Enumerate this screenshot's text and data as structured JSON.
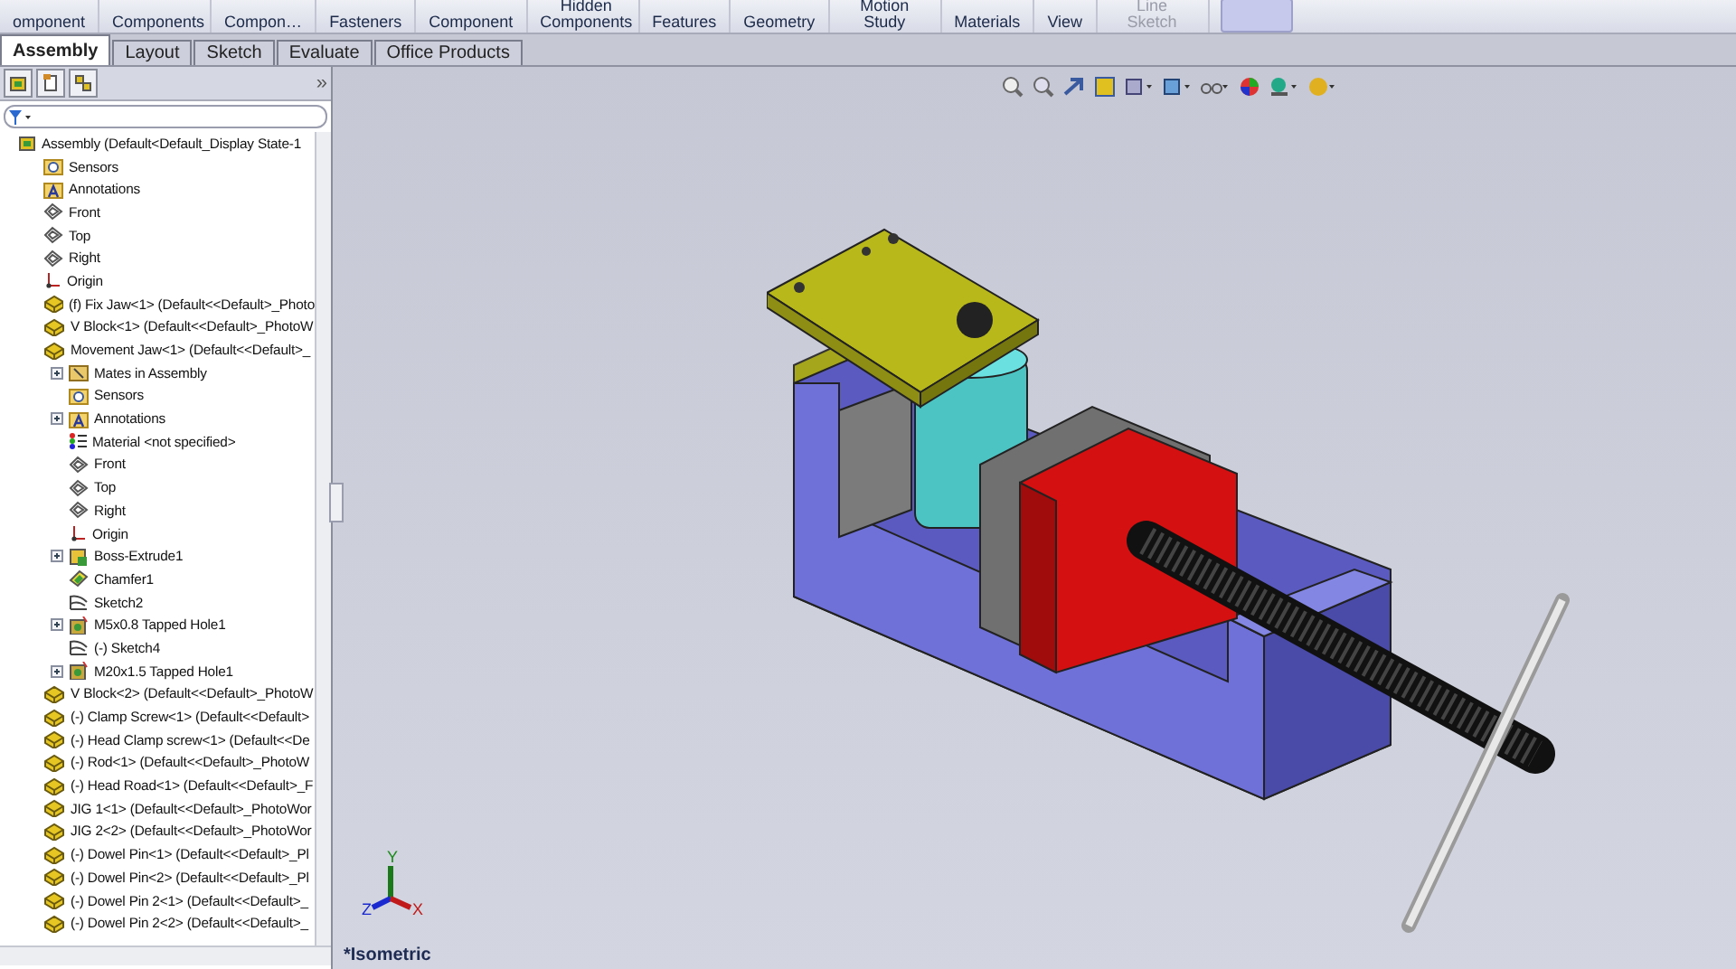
{
  "toolbar": {
    "buttons": [
      {
        "label": "omponent",
        "disabled": false
      },
      {
        "label": "Components",
        "disabled": false
      },
      {
        "label": "Compon…",
        "disabled": false
      },
      {
        "label": "Fasteners",
        "disabled": false
      },
      {
        "label": "Component",
        "disabled": false
      },
      {
        "label": "Hidden Components",
        "disabled": false
      },
      {
        "label": "Features",
        "disabled": false
      },
      {
        "label": "Geometry",
        "disabled": false
      },
      {
        "label": "Motion Study",
        "disabled": false
      },
      {
        "label": "Materials",
        "disabled": false
      },
      {
        "label": "View",
        "disabled": false
      },
      {
        "label": "Line Sketch",
        "disabled": true
      }
    ]
  },
  "tabs": [
    {
      "label": "Assembly",
      "selected": true
    },
    {
      "label": "Layout",
      "selected": false
    },
    {
      "label": "Sketch",
      "selected": false
    },
    {
      "label": "Evaluate",
      "selected": false
    },
    {
      "label": "Office Products",
      "selected": false
    }
  ],
  "panel": {
    "more": "»",
    "tree": [
      {
        "label": "Assembly  (Default<Default_Display State-1",
        "kind": "assembly",
        "expandable": false,
        "children": [
          {
            "label": "Sensors",
            "kind": "sensor",
            "expandable": false
          },
          {
            "label": "Annotations",
            "kind": "annotation",
            "expandable": false
          },
          {
            "label": "Front",
            "kind": "plane",
            "expandable": false
          },
          {
            "label": "Top",
            "kind": "plane",
            "expandable": false
          },
          {
            "label": "Right",
            "kind": "plane",
            "expandable": false
          },
          {
            "label": "Origin",
            "kind": "origin",
            "expandable": false
          },
          {
            "label": "(f) Fix Jaw<1> (Default<<Default>_Photo",
            "kind": "part",
            "expandable": false
          },
          {
            "label": "V Block<1> (Default<<Default>_PhotoW",
            "kind": "part",
            "expandable": false
          },
          {
            "label": "Movement Jaw<1> (Default<<Default>_",
            "kind": "part",
            "expandable": false,
            "children": [
              {
                "label": "Mates in Assembly",
                "kind": "mates",
                "expandable": true
              },
              {
                "label": "Sensors",
                "kind": "sensor",
                "expandable": false
              },
              {
                "label": "Annotations",
                "kind": "annotation",
                "expandable": true
              },
              {
                "label": "Material <not specified>",
                "kind": "material",
                "expandable": false
              },
              {
                "label": "Front",
                "kind": "plane",
                "expandable": false
              },
              {
                "label": "Top",
                "kind": "plane",
                "expandable": false
              },
              {
                "label": "Right",
                "kind": "plane",
                "expandable": false
              },
              {
                "label": "Origin",
                "kind": "origin",
                "expandable": false
              },
              {
                "label": "Boss-Extrude1",
                "kind": "extrude",
                "expandable": true
              },
              {
                "label": "Chamfer1",
                "kind": "chamfer",
                "expandable": false
              },
              {
                "label": "Sketch2",
                "kind": "sketch",
                "expandable": false
              },
              {
                "label": "M5x0.8 Tapped Hole1",
                "kind": "hole",
                "expandable": true
              },
              {
                "label": "(-) Sketch4",
                "kind": "sketch",
                "expandable": false
              },
              {
                "label": "M20x1.5 Tapped Hole1",
                "kind": "hole",
                "expandable": true
              }
            ]
          },
          {
            "label": "V Block<2> (Default<<Default>_PhotoW",
            "kind": "part",
            "expandable": false
          },
          {
            "label": "(-) Clamp Screw<1> (Default<<Default>",
            "kind": "part",
            "expandable": false
          },
          {
            "label": "(-) Head Clamp screw<1> (Default<<De",
            "kind": "part",
            "expandable": false
          },
          {
            "label": "(-) Rod<1> (Default<<Default>_PhotoW",
            "kind": "part",
            "expandable": false
          },
          {
            "label": "(-) Head Road<1> (Default<<Default>_F",
            "kind": "part",
            "expandable": false
          },
          {
            "label": "JIG 1<1> (Default<<Default>_PhotoWor",
            "kind": "part",
            "expandable": false
          },
          {
            "label": "JIG 2<2> (Default<<Default>_PhotoWor",
            "kind": "part",
            "expandable": false
          },
          {
            "label": "(-) Dowel Pin<1> (Default<<Default>_Pl",
            "kind": "part",
            "expandable": false
          },
          {
            "label": "(-) Dowel Pin<2> (Default<<Default>_Pl",
            "kind": "part",
            "expandable": false
          },
          {
            "label": "(-) Dowel Pin 2<1> (Default<<Default>_",
            "kind": "part",
            "expandable": false
          },
          {
            "label": "(-) Dowel Pin 2<2> (Default<<Default>_",
            "kind": "part",
            "expandable": false
          }
        ]
      }
    ]
  },
  "viewport": {
    "axes": {
      "x": "X",
      "y": "Y",
      "z": "Z"
    },
    "view_name": "*Isometric"
  }
}
